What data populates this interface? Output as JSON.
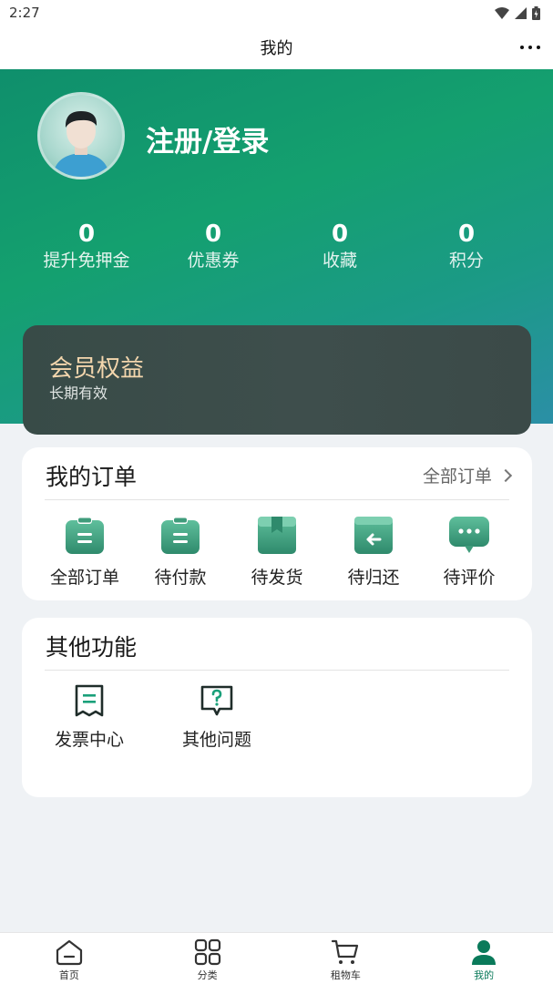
{
  "status_bar": {
    "time": "2:27"
  },
  "nav": {
    "title": "我的"
  },
  "profile": {
    "login_label": "注册/登录"
  },
  "stats": [
    {
      "value": "0",
      "label": "提升免押金"
    },
    {
      "value": "0",
      "label": "优惠券"
    },
    {
      "value": "0",
      "label": "收藏"
    },
    {
      "value": "0",
      "label": "积分"
    }
  ],
  "member": {
    "title": "会员权益",
    "subtitle": "长期有效"
  },
  "orders": {
    "title": "我的订单",
    "all_link": "全部订单",
    "items": [
      {
        "label": "全部订单",
        "icon": "clipboard-icon"
      },
      {
        "label": "待付款",
        "icon": "clipboard-icon"
      },
      {
        "label": "待发货",
        "icon": "box-icon"
      },
      {
        "label": "待归还",
        "icon": "return-box-icon"
      },
      {
        "label": "待评价",
        "icon": "chat-bubble-icon"
      }
    ]
  },
  "other": {
    "title": "其他功能",
    "items": [
      {
        "label": "发票中心",
        "icon": "invoice-icon"
      },
      {
        "label": "其他问题",
        "icon": "question-bubble-icon"
      }
    ]
  },
  "tabbar": [
    {
      "label": "首页",
      "icon": "home-icon",
      "active": false
    },
    {
      "label": "分类",
      "icon": "grid-icon",
      "active": false
    },
    {
      "label": "租物车",
      "icon": "cart-icon",
      "active": false
    },
    {
      "label": "我的",
      "icon": "user-icon",
      "active": true
    }
  ],
  "colors": {
    "accent": "#0a7a5a",
    "member_text": "#f3d6ad"
  }
}
